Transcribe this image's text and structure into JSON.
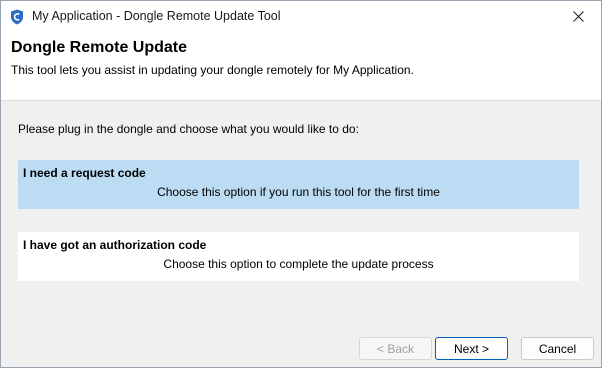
{
  "window": {
    "title": "My Application - Dongle Remote Update Tool",
    "icon": "shield-icon",
    "close_icon": "close-icon"
  },
  "header": {
    "title": "Dongle Remote Update",
    "subtitle": "This tool lets you assist in updating your dongle remotely for My Application."
  },
  "main": {
    "instruction": "Please plug in the dongle and choose what you would like to do:",
    "options": [
      {
        "title": "I need a request code",
        "description": "Choose this option if you run this tool for the first time",
        "selected": true
      },
      {
        "title": "I have got an authorization code",
        "description": "Choose this option to complete the update process",
        "selected": false
      }
    ]
  },
  "footer": {
    "back_label": "< Back",
    "next_label": "Next >",
    "cancel_label": "Cancel"
  },
  "colors": {
    "selected_option": "#bcdcf4",
    "default_button_border": "#005fb8"
  }
}
